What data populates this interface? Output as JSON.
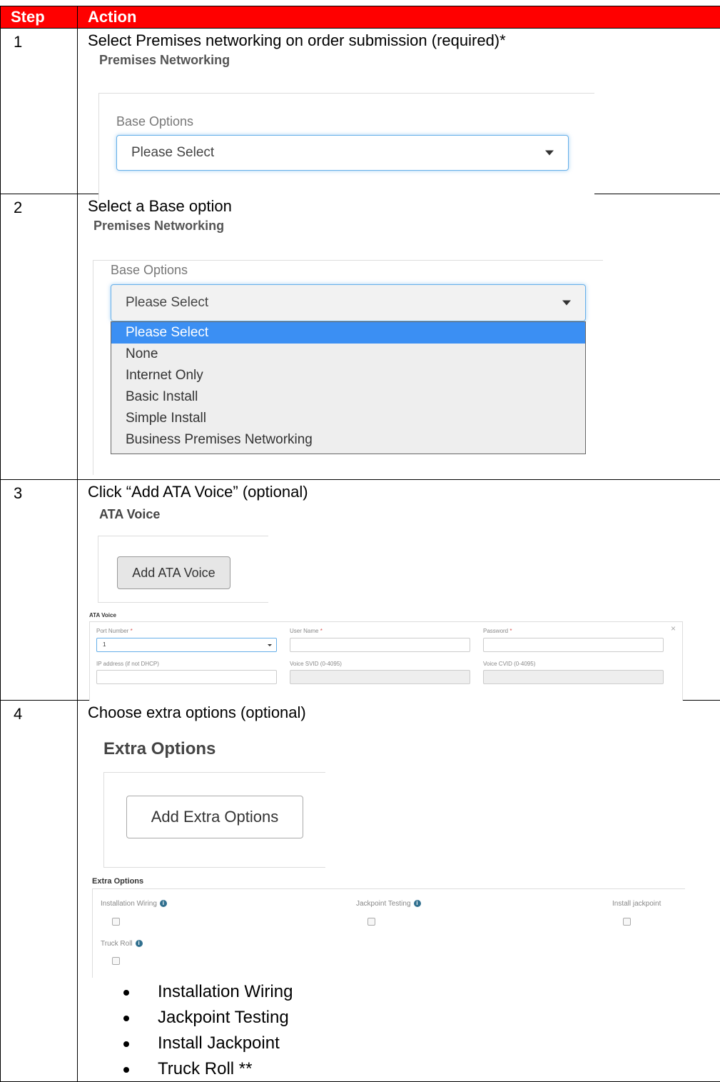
{
  "table": {
    "header": {
      "step": "Step",
      "action": "Action"
    },
    "rows": [
      {
        "step": "1",
        "title": "Select Premises networking on order submission (required)*",
        "snapshot": {
          "section": "Premises Networking",
          "label": "Base Options",
          "select_value": "Please Select"
        }
      },
      {
        "step": "2",
        "title": "Select a Base option",
        "snapshot": {
          "section": "Premises Networking",
          "label": "Base Options",
          "select_value": "Please Select",
          "options": [
            "Please Select",
            "None",
            "Internet Only",
            "Basic Install",
            "Simple Install",
            "Business Premises Networking"
          ]
        }
      },
      {
        "step": "3",
        "title": "Click “Add ATA Voice” (optional)",
        "snapshot": {
          "section": "ATA Voice",
          "button": "Add ATA Voice",
          "form": {
            "title": "ATA Voice",
            "port_label": "Port Number",
            "port_value": "1",
            "user_label": "User Name",
            "password_label": "Password",
            "ip_label": "IP address (if not DHCP)",
            "svid_label": "Voice SVID (0-4095)",
            "cvid_label": "Voice CVID (0-4095)",
            "close": "×",
            "required_mark": "*"
          }
        }
      },
      {
        "step": "4",
        "title": "Choose extra options (optional)",
        "snapshot": {
          "section": "Extra Options",
          "button": "Add Extra Options",
          "form": {
            "title": "Extra Options",
            "opt1": "Installation Wiring",
            "opt2": "Jackpoint Testing",
            "opt3": "Install jackpoint",
            "opt4": "Truck Roll",
            "info": "i"
          }
        },
        "bullets": [
          "Installation Wiring",
          "Jackpoint Testing",
          "Install Jackpoint",
          "Truck Roll **"
        ]
      }
    ]
  }
}
